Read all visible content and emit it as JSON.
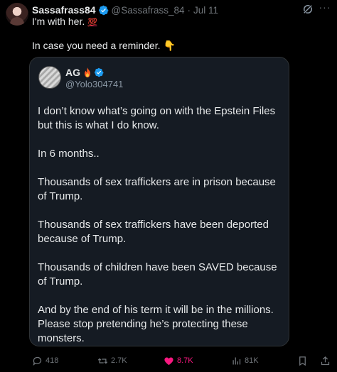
{
  "author": {
    "display_name": "Sassafrass84",
    "handle": "@Sassafrass_84",
    "separator": "·",
    "date": "Jul 11"
  },
  "tweet": {
    "line1_text": "I'm with her.",
    "line1_emoji": "💯",
    "line2_text": "In case you need a reminder.",
    "line2_emoji": "👇"
  },
  "quote": {
    "display_name": "AG",
    "handle": "@Yolo304741",
    "paragraphs": [
      "I don’t know what’s going on with the Epstein Files but this is what I do know.",
      "In 6 months..",
      "Thousands of sex traffickers are in prison because of Trump.",
      "Thousands of sex traffickers have been deported because of Trump.",
      "Thousands of children have been SAVED because of Trump.",
      "And by the end of his term it will be in the millions. Please stop pretending he’s protecting these monsters."
    ]
  },
  "actions": {
    "replies": "418",
    "reposts": "2.7K",
    "likes": "8.7K",
    "views": "81K"
  },
  "icons": {
    "verified": "verified-badge-icon",
    "fire": "fire-icon",
    "grok": "grok-icon",
    "more": "more-icon",
    "reply": "reply-icon",
    "repost": "repost-icon",
    "like": "heart-icon",
    "views": "views-icon",
    "bookmark": "bookmark-icon",
    "share": "share-icon"
  },
  "colors": {
    "background": "#000000",
    "card": "#151b23",
    "text": "#e7e9ea",
    "muted": "#71767b",
    "verified": "#1d9bf0",
    "like": "#f91880"
  }
}
